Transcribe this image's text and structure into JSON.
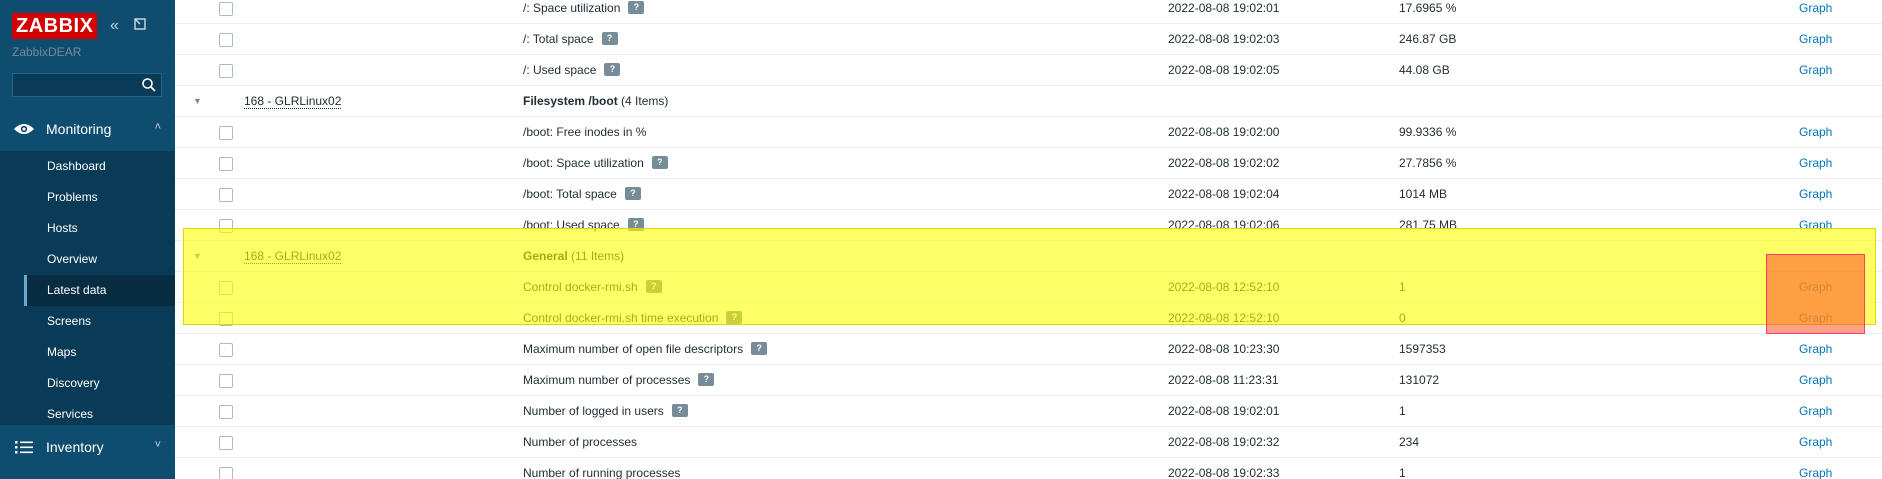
{
  "app": {
    "logo_text": "ZABBIX",
    "server_name": "ZabbixDEAR",
    "search": {
      "value": "",
      "placeholder": ""
    }
  },
  "sidebar": {
    "monitoring": {
      "label": "Monitoring",
      "icon": "eye-icon",
      "expanded": true
    },
    "items": [
      {
        "label": "Dashboard",
        "selected": false
      },
      {
        "label": "Problems",
        "selected": false
      },
      {
        "label": "Hosts",
        "selected": false
      },
      {
        "label": "Overview",
        "selected": false
      },
      {
        "label": "Latest data",
        "selected": true
      },
      {
        "label": "Screens",
        "selected": false
      },
      {
        "label": "Maps",
        "selected": false
      },
      {
        "label": "Discovery",
        "selected": false
      },
      {
        "label": "Services",
        "selected": false
      }
    ],
    "inventory": {
      "label": "Inventory",
      "icon": "list-icon",
      "expanded": false
    }
  },
  "table": {
    "rows": [
      {
        "type": "item",
        "name": "/: Space utilization",
        "help": true,
        "time": "2022-08-08 19:02:01",
        "value": "17.6965 %",
        "graph": "Graph"
      },
      {
        "type": "item",
        "name": "/: Total space",
        "help": true,
        "time": "2022-08-08 19:02:03",
        "value": "246.87 GB",
        "graph": "Graph"
      },
      {
        "type": "item",
        "name": "/: Used space",
        "help": true,
        "time": "2022-08-08 19:02:05",
        "value": "44.08 GB",
        "graph": "Graph"
      },
      {
        "type": "group",
        "host": "168 - GLRLinux02",
        "group": "Filesystem /boot",
        "count": "(4 Items)"
      },
      {
        "type": "item",
        "name": "/boot: Free inodes in %",
        "help": false,
        "time": "2022-08-08 19:02:00",
        "value": "99.9336 %",
        "graph": "Graph"
      },
      {
        "type": "item",
        "name": "/boot: Space utilization",
        "help": true,
        "time": "2022-08-08 19:02:02",
        "value": "27.7856 %",
        "graph": "Graph"
      },
      {
        "type": "item",
        "name": "/boot: Total space",
        "help": true,
        "time": "2022-08-08 19:02:04",
        "value": "1014 MB",
        "graph": "Graph"
      },
      {
        "type": "item",
        "name": "/boot: Used space",
        "help": true,
        "time": "2022-08-08 19:02:06",
        "value": "281.75 MB",
        "graph": "Graph"
      },
      {
        "type": "group",
        "host": "168 - GLRLinux02",
        "group": "General",
        "count": "(11 Items)"
      },
      {
        "type": "item",
        "name": "Control docker-rmi.sh",
        "help": true,
        "time": "2022-08-08 12:52:10",
        "value": "1",
        "graph": "Graph"
      },
      {
        "type": "item",
        "name": "Control docker-rmi.sh time execution",
        "help": true,
        "time": "2022-08-08 12:52:10",
        "value": "0",
        "graph": "Graph"
      },
      {
        "type": "item",
        "name": "Maximum number of open file descriptors",
        "help": true,
        "time": "2022-08-08 10:23:30",
        "value": "1597353",
        "graph": "Graph"
      },
      {
        "type": "item",
        "name": "Maximum number of processes",
        "help": true,
        "time": "2022-08-08 11:23:31",
        "value": "131072",
        "graph": "Graph"
      },
      {
        "type": "item",
        "name": "Number of logged in users",
        "help": true,
        "time": "2022-08-08 19:02:01",
        "value": "1",
        "graph": "Graph"
      },
      {
        "type": "item",
        "name": "Number of processes",
        "help": false,
        "time": "2022-08-08 19:02:32",
        "value": "234",
        "graph": "Graph"
      },
      {
        "type": "item",
        "name": "Number of running processes",
        "help": false,
        "time": "2022-08-08 19:02:33",
        "value": "1",
        "graph": "Graph"
      }
    ],
    "help_glyph": "?",
    "toggle_glyph": "▼"
  },
  "colors": {
    "sidebar_bg": "#0e4d70",
    "submenu_bg": "#0a3b56",
    "logo_red": "#d40000",
    "link_blue": "#0275b8",
    "highlight_yellow": "#ffff00",
    "highlight_red": "#ff5028"
  }
}
